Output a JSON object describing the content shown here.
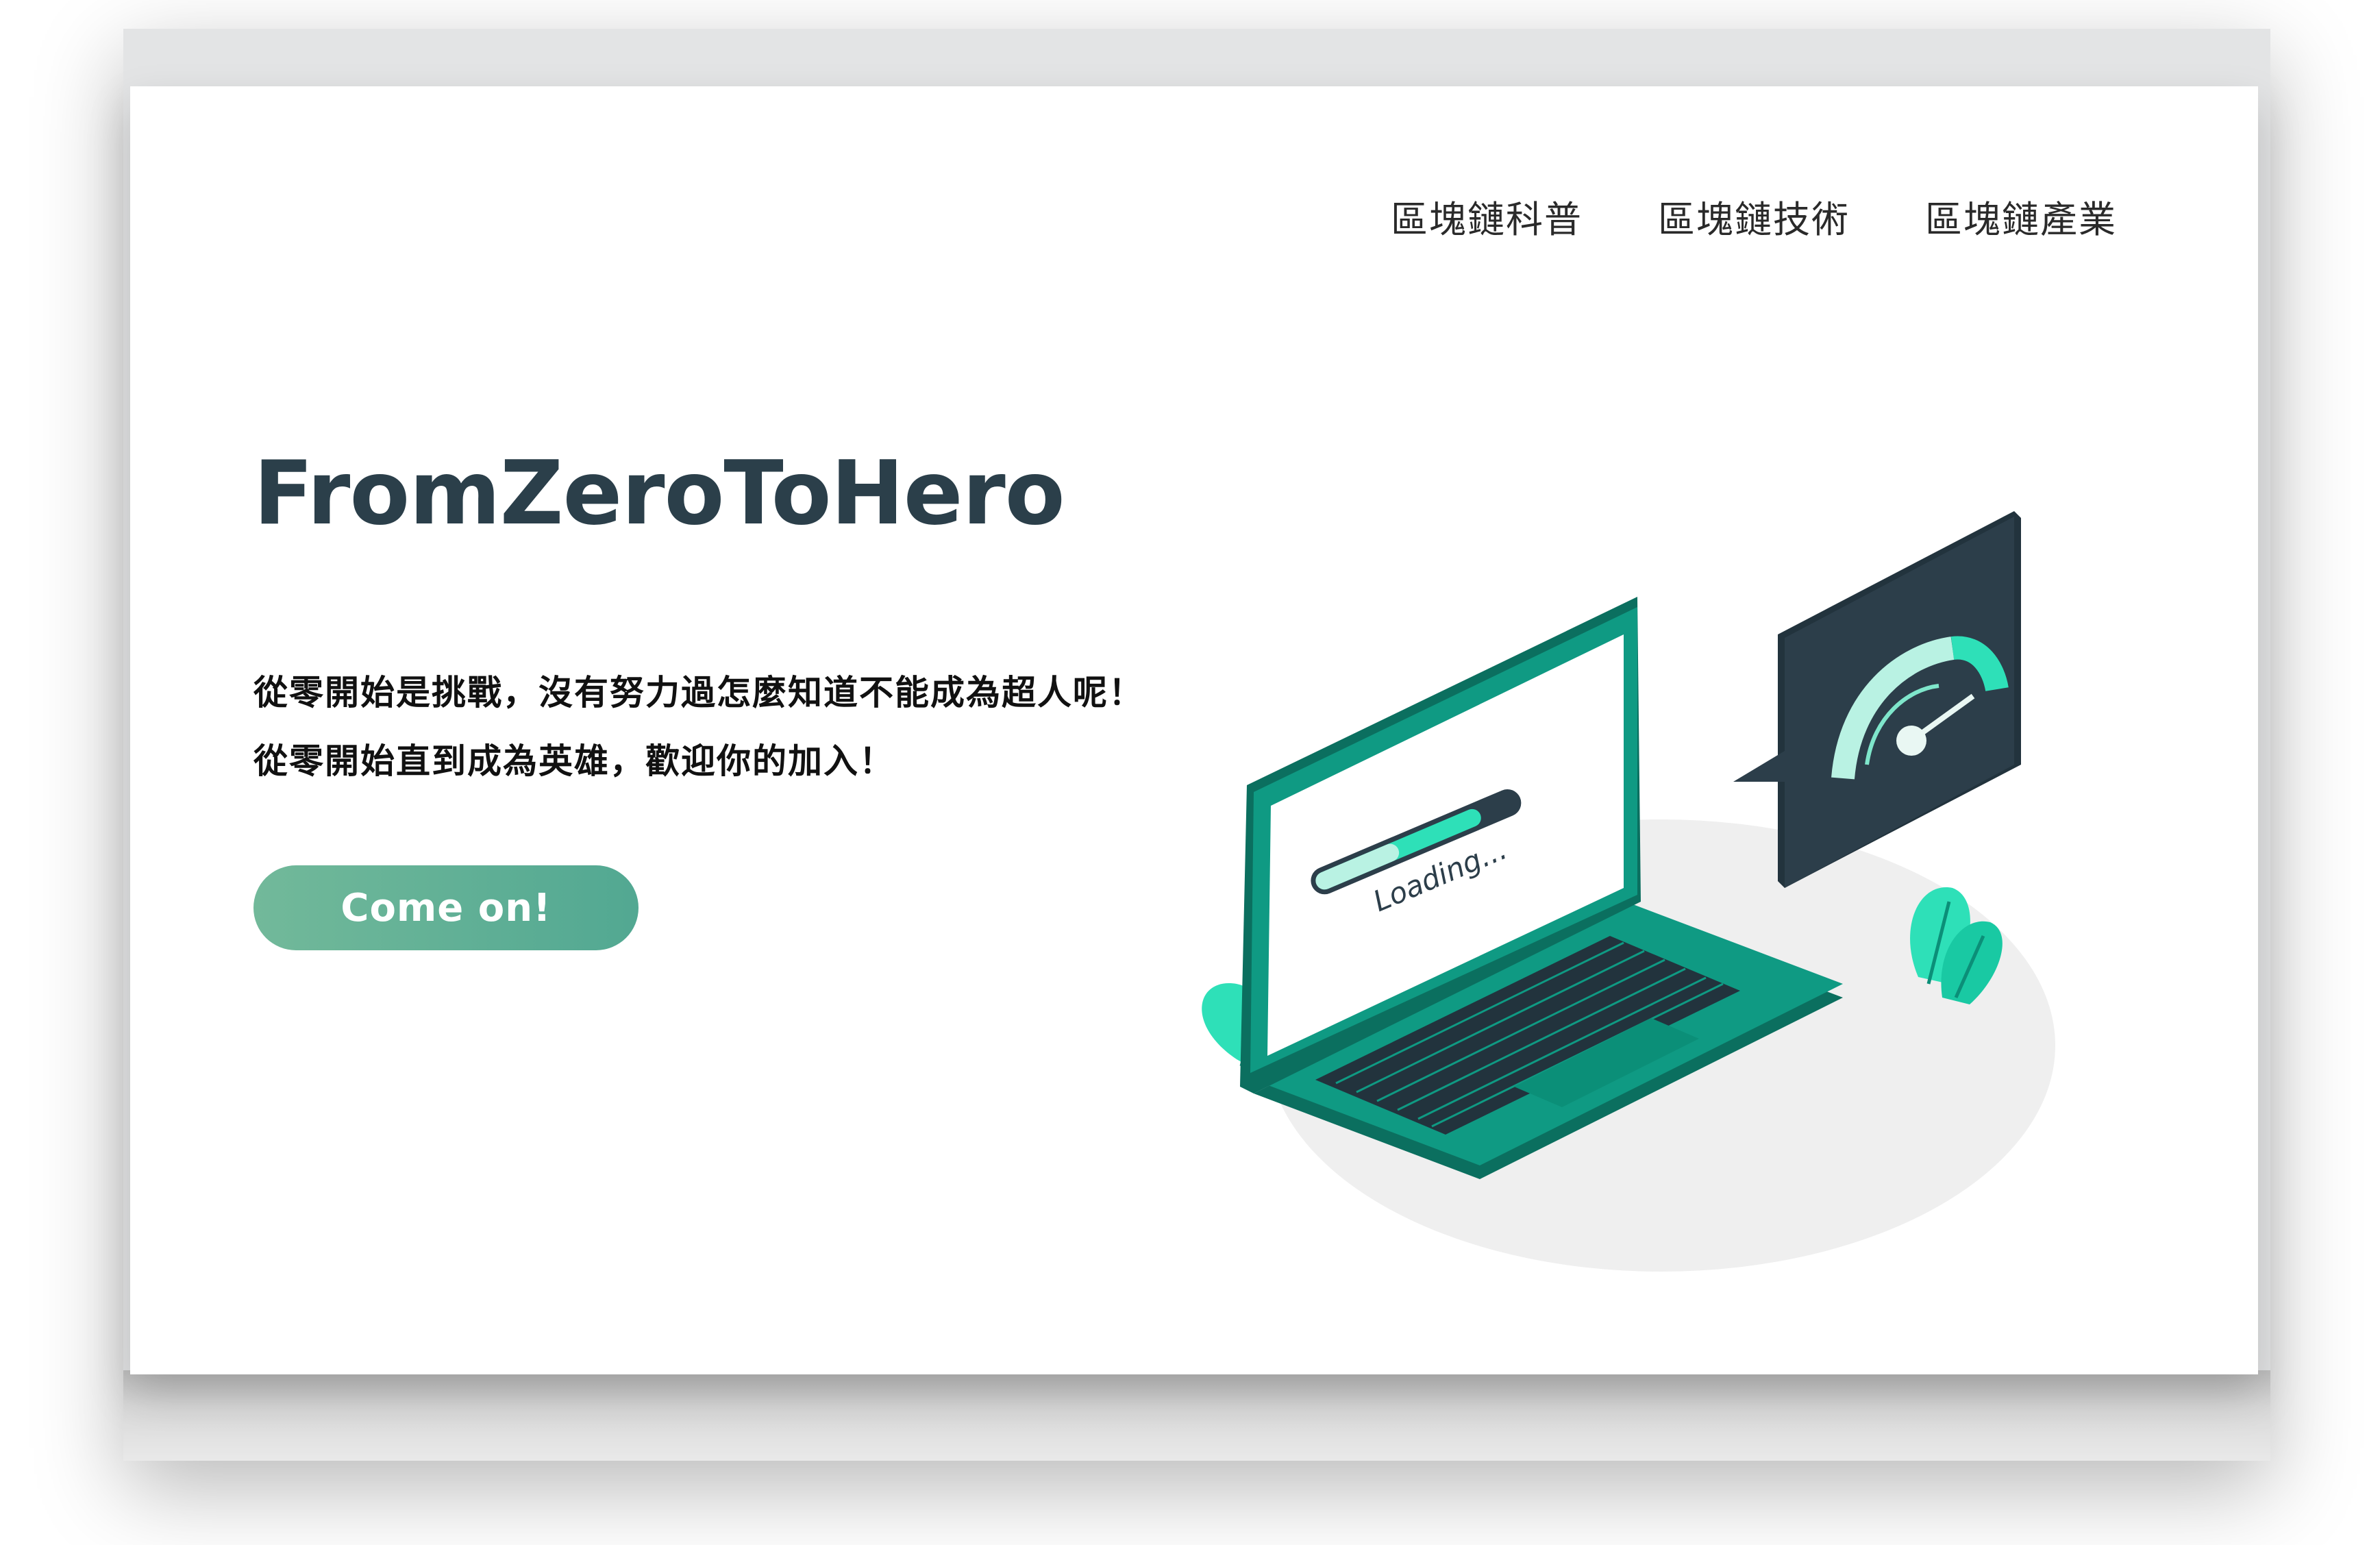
{
  "nav": {
    "items": [
      {
        "label": "區塊鏈科普"
      },
      {
        "label": "區塊鏈技術"
      },
      {
        "label": "區塊鏈產業"
      }
    ]
  },
  "hero": {
    "title": "FromZeroToHero",
    "lines": [
      "從零開始是挑戰，沒有努力過怎麼知道不能成為超人呢！",
      "從零開始直到成為英雄，歡迎你的加入！"
    ],
    "cta_label": "Come on!"
  },
  "illustration": {
    "screen_text": "Loading...",
    "icons": [
      "laptop-icon",
      "speedometer-icon",
      "plant-icon"
    ]
  },
  "colors": {
    "title": "#2b3f4a",
    "accent": "#52a892",
    "laptop": "#0f9a83",
    "laptop_dark": "#0b6f5f",
    "panel": "#2c3e4a",
    "mint": "#2ee0b8"
  }
}
